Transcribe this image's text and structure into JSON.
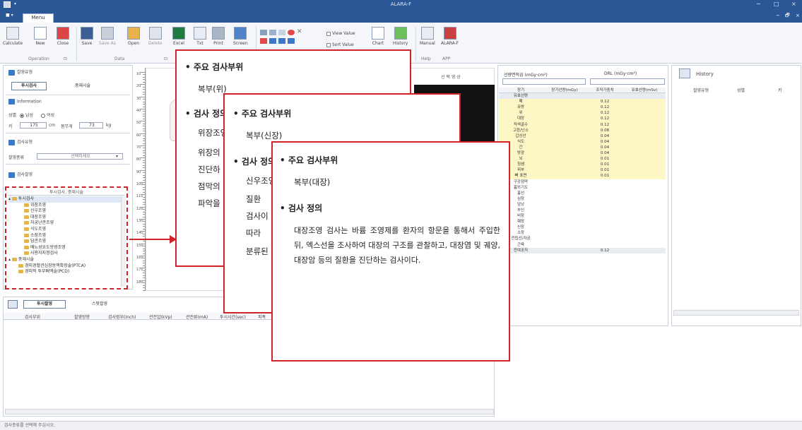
{
  "window": {
    "title": "ALARA-F",
    "quick_access": "▾",
    "controls": {
      "minimize": "−",
      "maximize": "□",
      "close": "×",
      "min2": "−",
      "restore": "🗗",
      "close2": "×"
    }
  },
  "menu": {
    "file_button": "■ ▾",
    "tab": "Menu"
  },
  "ribbon": {
    "groups": {
      "operation": "Operation",
      "data": "Data",
      "help": "Help",
      "app": "APP"
    },
    "buttons": {
      "calculate": "Calculate",
      "new": "New",
      "close": "Close",
      "save": "Save",
      "save_as": "Save As",
      "open": "Open",
      "delete": "Delete",
      "excel": "Excel",
      "txt": "Txt",
      "print": "Print",
      "screen": "Screen",
      "chart": "Chart",
      "history": "History",
      "manual": "Manual",
      "alara_f": "ALARA-F"
    },
    "checkboxes": {
      "view_value": "View Value",
      "sort_value": "Sort Value"
    }
  },
  "left_panel": {
    "exam_type_header": "촬영유형",
    "tabs": {
      "fluoro": "투시검사",
      "intervention": "중재시술"
    },
    "information_header": "Information",
    "gender_label": "성별",
    "gender_male": "남성",
    "gender_female": "여성",
    "height_label": "키",
    "height_value": "175",
    "height_unit": "cm",
    "weight_label": "몸무게",
    "weight_value": "73",
    "weight_unit": "kg",
    "exam_type_section": "검사유형",
    "exam_category_label": "촬영종류",
    "exam_category_placeholder": "선택하세요",
    "exam_list_header": "검사촬영",
    "tree_header": "투시검사, 중재시술",
    "tree": {
      "root_fluoro": "투시검사",
      "items": [
        "위장조영",
        "신우조영",
        "대장조영",
        "자궁난관조영",
        "식도조영",
        "소장조영",
        "담관조영",
        "배뇨성요도방광조영",
        "사용자지정검사"
      ],
      "root_intervention": "중재시술",
      "int_items": [
        "경피경혈관심장동맥확장술(PTCA)",
        "경피적 투부배액술(PCD)"
      ]
    }
  },
  "ruler": {
    "labels": [
      "10",
      "20",
      "30",
      "40",
      "50",
      "60",
      "70",
      "80",
      "90",
      "100",
      "110",
      "120",
      "130",
      "140",
      "150",
      "160",
      "170",
      "180"
    ]
  },
  "image_view": {
    "title": "선 택 영 상"
  },
  "bottom": {
    "tabs": {
      "fluoro_shot": "투시촬영",
      "spot_shot": "스팟촬영"
    },
    "columns": [
      "검사부위",
      "촬영방향",
      "검사범위(Inch)",
      "관전압(kVp)",
      "관전류(mA)",
      "투시시간(sec)",
      "피폭"
    ]
  },
  "dose_panel": {
    "area_dose_label": "선량면적곱 (mGy·cm²)",
    "drl_label": "DRL (mGy·cm²)",
    "columns": [
      "장기",
      "장기선량(mGy)",
      "조직가중치",
      "유효선량(mSv)"
    ],
    "group_label": "유효선량",
    "rows": [
      {
        "organ": "폐",
        "w": "0.12"
      },
      {
        "organ": "유방",
        "w": "0.12"
      },
      {
        "organ": "위",
        "w": "0.12"
      },
      {
        "organ": "대장",
        "w": "0.12"
      },
      {
        "organ": "적색골수",
        "w": "0.12"
      },
      {
        "organ": "고환/난소",
        "w": "0.08"
      },
      {
        "organ": "갑상선",
        "w": "0.04"
      },
      {
        "organ": "식도",
        "w": "0.04"
      },
      {
        "organ": "간",
        "w": "0.04"
      },
      {
        "organ": "방광",
        "w": "0.04"
      },
      {
        "organ": "뇌",
        "w": "0.01"
      },
      {
        "organ": "침샘",
        "w": "0.01"
      },
      {
        "organ": "피부",
        "w": "0.01"
      },
      {
        "organ": "뼈 표면",
        "w": "0.01"
      }
    ],
    "remainder": [
      "구강점막",
      "흉외기도",
      "흉선",
      "심장",
      "담낭",
      "부신",
      "비장",
      "췌장",
      "신장",
      "소장",
      "전립선/자궁",
      "근육"
    ],
    "remainder_total": {
      "organ": "잔여조직",
      "w": "0.12"
    }
  },
  "history": {
    "title": "History",
    "columns": [
      "촬영유형",
      "성별",
      "키"
    ]
  },
  "statusbar": {
    "text": "검사종류를 선택해 주십시오."
  },
  "callouts": {
    "one": {
      "site_heading": "• 주요 검사부위",
      "site_value": "복부(위)",
      "def_heading": "• 검사 정의",
      "lines": [
        "위장조영",
        "위장의",
        "진단하",
        "점막의",
        "파악을"
      ]
    },
    "two": {
      "site_heading": "• 주요 검사부위",
      "site_value": "복부(신장)",
      "def_heading": "• 검사 정의",
      "lines": [
        "신우조영",
        "질환",
        "검사이",
        "따라",
        "분류된"
      ]
    },
    "three": {
      "site_heading": "• 주요 검사부위",
      "site_value": "복부(대장)",
      "def_heading": "• 검사 정의",
      "definition": "대장조영 검사는 바륨 조영제를 환자의 항문을 통해서 주입한 뒤, 엑스선을 조사하여 대장의 구조를 관찰하고, 대장염 및 궤양, 대장암 등의 질환을 진단하는 검사이다."
    }
  },
  "colors": {
    "title_bar": "#2b5797",
    "highlight_red": "#d1232a",
    "dose_yellow": "#fdf7c6"
  }
}
